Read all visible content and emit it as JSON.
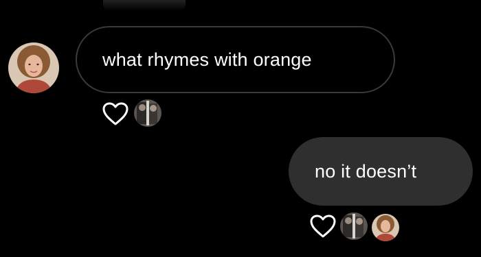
{
  "thread": {
    "messages": [
      {
        "direction": "incoming",
        "text": "what rhymes with orange",
        "avatar_icon": "user-avatar-icon",
        "reactions": [
          "heart-icon",
          "reactor-avatar-icon"
        ]
      },
      {
        "direction": "outgoing",
        "text": "no it doesn’t",
        "reactions": [
          "heart-icon",
          "reactor-avatar-icon",
          "user-avatar-icon"
        ]
      }
    ]
  },
  "colors": {
    "background": "#000000",
    "incoming_border": "#3a3a3a",
    "outgoing_bubble": "#2f2f2f",
    "text": "#ffffff"
  }
}
